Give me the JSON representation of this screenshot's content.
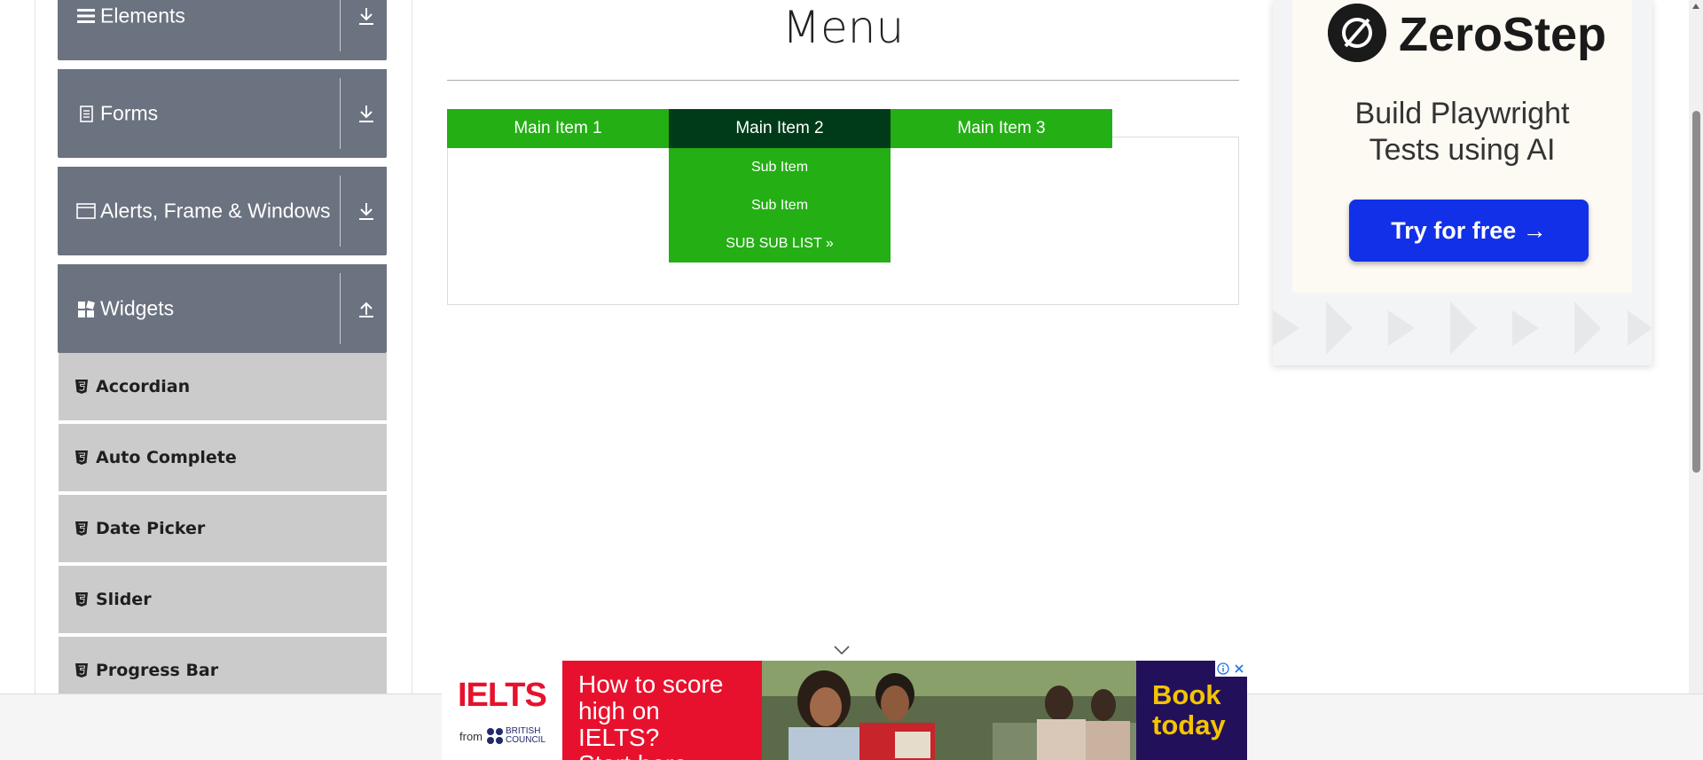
{
  "sidebar": {
    "groups": [
      {
        "label": "Elements",
        "icon": "list-icon",
        "arrow": "download-arrow-icon"
      },
      {
        "label": "Forms",
        "icon": "document-icon",
        "arrow": "download-arrow-icon"
      },
      {
        "label": "Alerts, Frame & Windows",
        "icon": "window-icon",
        "arrow": "download-arrow-icon"
      },
      {
        "label": "Widgets",
        "icon": "widgets-icon",
        "arrow": "upload-arrow-icon"
      }
    ],
    "items": [
      {
        "label": "Accordian",
        "icon": "html5-icon"
      },
      {
        "label": "Auto Complete",
        "icon": "html5-icon"
      },
      {
        "label": "Date Picker",
        "icon": "html5-icon"
      },
      {
        "label": "Slider",
        "icon": "html5-icon"
      },
      {
        "label": "Progress Bar",
        "icon": "html5-icon"
      }
    ]
  },
  "main": {
    "title": "Menu",
    "menu": {
      "items": [
        "Main Item 1",
        "Main Item 2",
        "Main Item 3"
      ],
      "active_index": 1,
      "dropdown": [
        "Sub Item",
        "Sub Item",
        "SUB SUB LIST »"
      ]
    }
  },
  "ad_right": {
    "brand": "ZeroStep",
    "headline_line1": "Build Playwright",
    "headline_line2": "Tests using AI",
    "cta": "Try for free →"
  },
  "ad_bottom": {
    "logo": "IELTS",
    "from": "from",
    "partner_line1": "BRITISH",
    "partner_line2": "COUNCIL",
    "headline_line1": "How to score",
    "headline_line2": "high on IELTS?",
    "headline_line3": "Start here",
    "cta_line1": "Book",
    "cta_line2": "today"
  },
  "colors": {
    "menu_green": "#24af15",
    "menu_active": "#003b19",
    "sidebar_group": "#6b7280",
    "sidebar_item": "#cbcbcb",
    "cta_blue": "#1230e8",
    "ielts_red": "#e8112d",
    "ielts_purple": "#22115a",
    "ielts_yellow": "#f5c400"
  }
}
